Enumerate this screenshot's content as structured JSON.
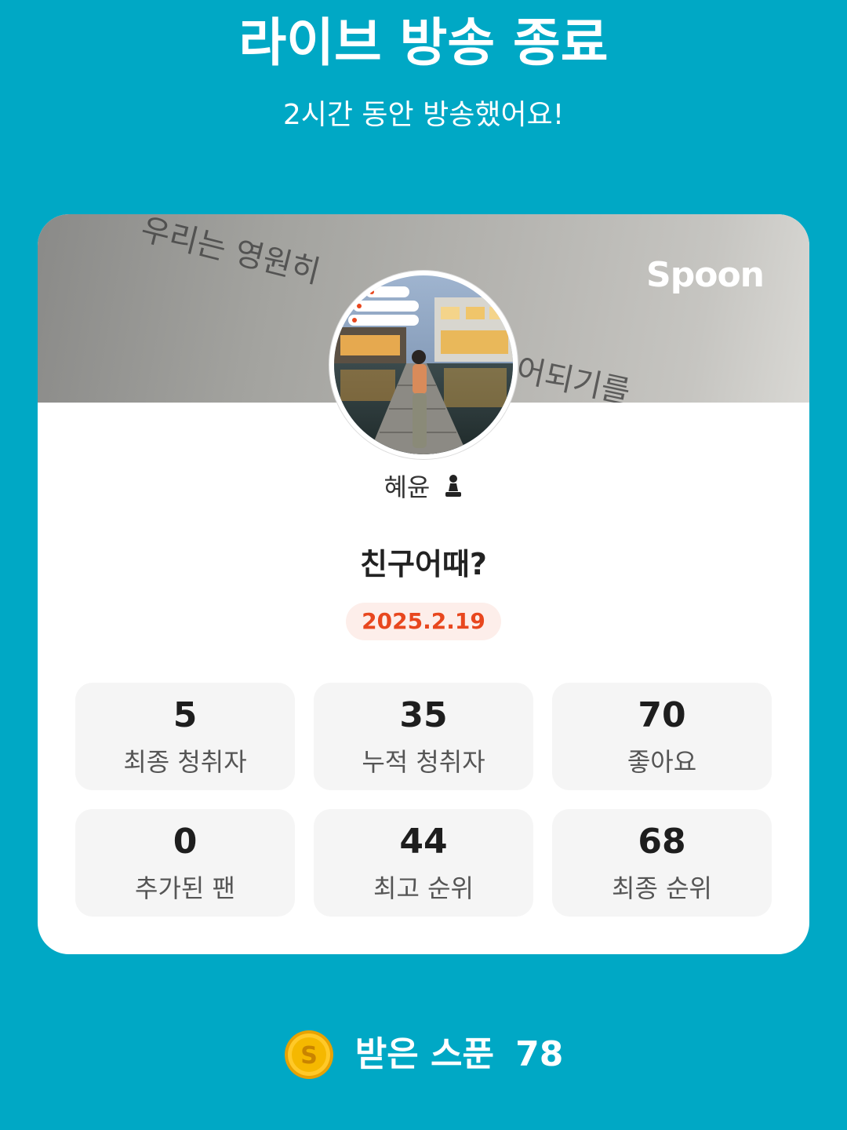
{
  "header": {
    "title": "라이브 방송 종료",
    "subtitle": "2시간 동안 방송했어요!"
  },
  "card": {
    "brand": "Spoon",
    "cover_text_1": "우리는 영원히",
    "cover_text_2": "어되기를",
    "streamer_name": "혜윤",
    "broadcast_title": "친구어때?",
    "date": "2025.2.19",
    "stats": [
      {
        "value": "5",
        "label": "최종 청취자"
      },
      {
        "value": "35",
        "label": "누적 청취자"
      },
      {
        "value": "70",
        "label": "좋아요"
      },
      {
        "value": "0",
        "label": "추가된 팬"
      },
      {
        "value": "44",
        "label": "최고 순위"
      },
      {
        "value": "68",
        "label": "최종 순위"
      }
    ]
  },
  "footer": {
    "coin_icon": "spoon-coin-icon",
    "spoon_label": "받은 스푼",
    "spoon_count": "78"
  },
  "colors": {
    "background": "#00a8c5",
    "date_text": "#e8471e",
    "date_bg": "#fdeeea",
    "coin": "#f5b800"
  }
}
